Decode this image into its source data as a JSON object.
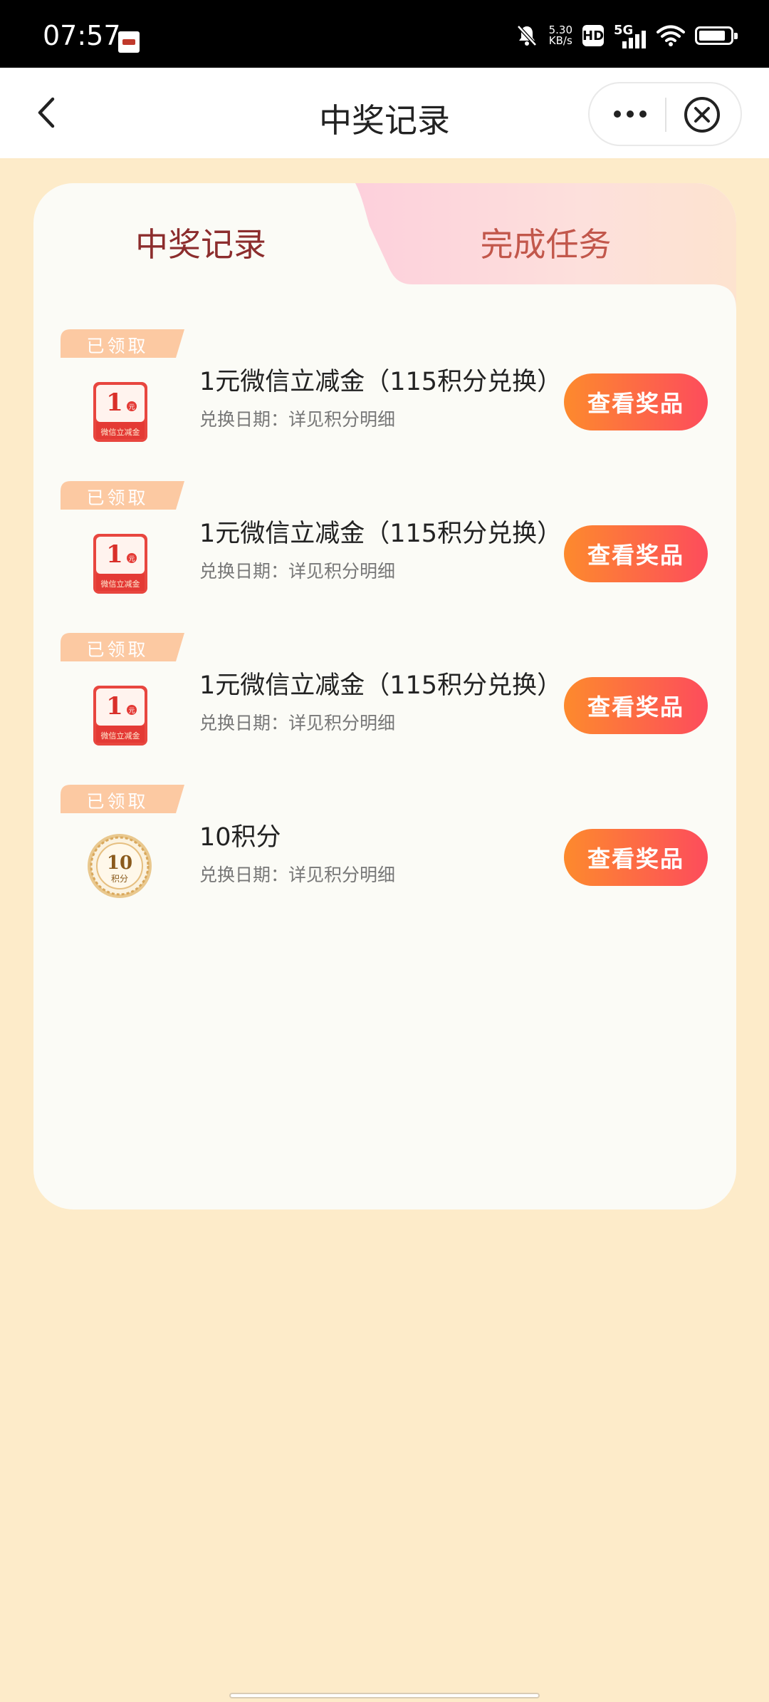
{
  "status_bar": {
    "time": "07:57",
    "net_speed_value": "5.30",
    "net_speed_unit": "KB/s",
    "hd_label": "HD",
    "network_label": "5G"
  },
  "nav": {
    "title": "中奖记录"
  },
  "tabs": [
    {
      "label": "中奖记录",
      "active": true
    },
    {
      "label": "完成任务",
      "active": false
    }
  ],
  "records": [
    {
      "status": "已领取",
      "title": "1元微信立减金（115积分兑换）",
      "subtitle": "兑换日期：详见积分明细",
      "button": "查看奖品",
      "icon": "red-envelope-coupon-icon"
    },
    {
      "status": "已领取",
      "title": "1元微信立减金（115积分兑换）",
      "subtitle": "兑换日期：详见积分明细",
      "button": "查看奖品",
      "icon": "red-envelope-coupon-icon"
    },
    {
      "status": "已领取",
      "title": "1元微信立减金（115积分兑换）",
      "subtitle": "兑换日期：详见积分明细",
      "button": "查看奖品",
      "icon": "red-envelope-coupon-icon"
    },
    {
      "status": "已领取",
      "title": "10积分",
      "subtitle": "兑换日期：详见积分明细",
      "button": "查看奖品",
      "icon": "gold-coin-icon"
    }
  ],
  "coupon_icon": {
    "amount": "1",
    "unit": "元",
    "caption": "微信立减金"
  },
  "coin_icon": {
    "amount": "10",
    "caption": "积分"
  },
  "colors": {
    "background": "#fdebc9",
    "card": "#fbfbf6",
    "active_tab_text": "#8c2d2d",
    "inactive_tab_text": "#c2574b",
    "button_gradient_start": "#fd8a2d",
    "button_gradient_end": "#fd4c5c"
  }
}
